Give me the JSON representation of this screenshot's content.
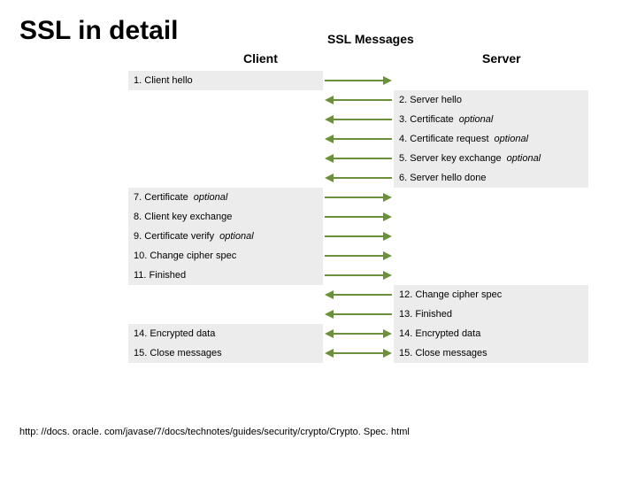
{
  "title": "SSL in detail",
  "subtitle": "SSL Messages",
  "columns": {
    "client": "Client",
    "server": "Server"
  },
  "optional": "optional",
  "messages": {
    "client1": {
      "num": "1.",
      "text": "Client hello"
    },
    "server2": {
      "num": "2.",
      "text": "Server hello"
    },
    "server3": {
      "num": "3.",
      "text": "Certificate",
      "optional": true
    },
    "server4": {
      "num": "4.",
      "text": "Certificate request",
      "optional": true
    },
    "server5": {
      "num": "5.",
      "text": "Server key exchange",
      "optional": true
    },
    "server6": {
      "num": "6.",
      "text": "Server hello done"
    },
    "client7": {
      "num": "7.",
      "text": "Certificate",
      "optional": true
    },
    "client8": {
      "num": "8.",
      "text": "Client key exchange"
    },
    "client9": {
      "num": "9.",
      "text": "Certificate verify",
      "optional": true
    },
    "client10": {
      "num": "10.",
      "text": "Change cipher spec"
    },
    "client11": {
      "num": "11.",
      "text": "Finished"
    },
    "server12": {
      "num": "12.",
      "text": "Change cipher spec"
    },
    "server13": {
      "num": "13.",
      "text": "Finished"
    },
    "client14": {
      "num": "14.",
      "text": "Encrypted data"
    },
    "server14": {
      "num": "14.",
      "text": "Encrypted data"
    },
    "client15": {
      "num": "15.",
      "text": "Close messages"
    },
    "server15": {
      "num": "15.",
      "text": "Close messages"
    }
  },
  "footer": "http: //docs. oracle. com/javase/7/docs/technotes/guides/security/crypto/Crypto. Spec. html"
}
